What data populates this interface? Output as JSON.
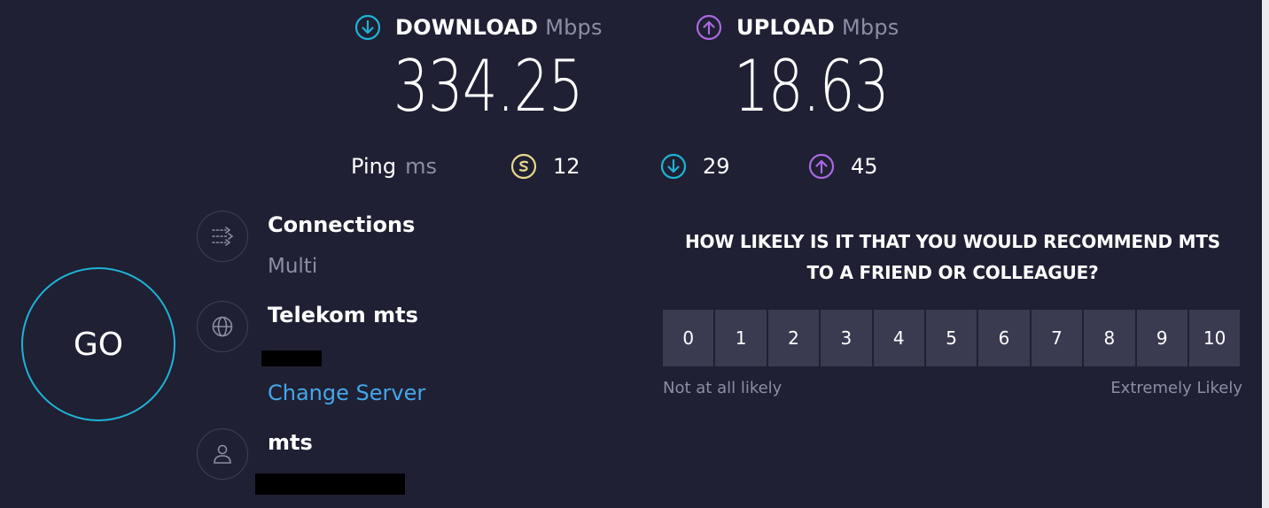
{
  "header": {
    "download": {
      "label": "DOWNLOAD",
      "unit": "Mbps",
      "value": "334.25",
      "icon": "download-arrow-icon",
      "color": "#1fb3d6"
    },
    "upload": {
      "label": "UPLOAD",
      "unit": "Mbps",
      "value": "18.63",
      "icon": "upload-arrow-icon",
      "color": "#a968e0"
    }
  },
  "ping": {
    "label": "Ping",
    "unit": "ms",
    "idle": {
      "value": "12",
      "icon": "ping-idle-icon",
      "color": "#e8d98c"
    },
    "download": {
      "value": "29",
      "icon": "download-arrow-icon",
      "color": "#1fb3d6"
    },
    "upload": {
      "value": "45",
      "icon": "upload-arrow-icon",
      "color": "#a968e0"
    }
  },
  "go_button": {
    "label": "GO"
  },
  "connections": {
    "title": "Connections",
    "mode": "Multi",
    "icon": "connections-icon"
  },
  "server": {
    "name": "Telekom mts",
    "change_label": "Change Server",
    "icon": "globe-icon"
  },
  "provider": {
    "name": "mts",
    "icon": "user-icon"
  },
  "survey": {
    "question_line1": "HOW LIKELY IS IT THAT YOU WOULD RECOMMEND MTS",
    "question_line2": "TO A FRIEND OR COLLEAGUE?",
    "options": [
      "0",
      "1",
      "2",
      "3",
      "4",
      "5",
      "6",
      "7",
      "8",
      "9",
      "10"
    ],
    "low_label": "Not at all likely",
    "high_label": "Extremely Likely"
  },
  "colors": {
    "background": "#1f2033",
    "accent_cyan": "#1fb3d6",
    "accent_purple": "#a968e0",
    "link": "#45a7ea",
    "muted": "#8c8ea6"
  }
}
